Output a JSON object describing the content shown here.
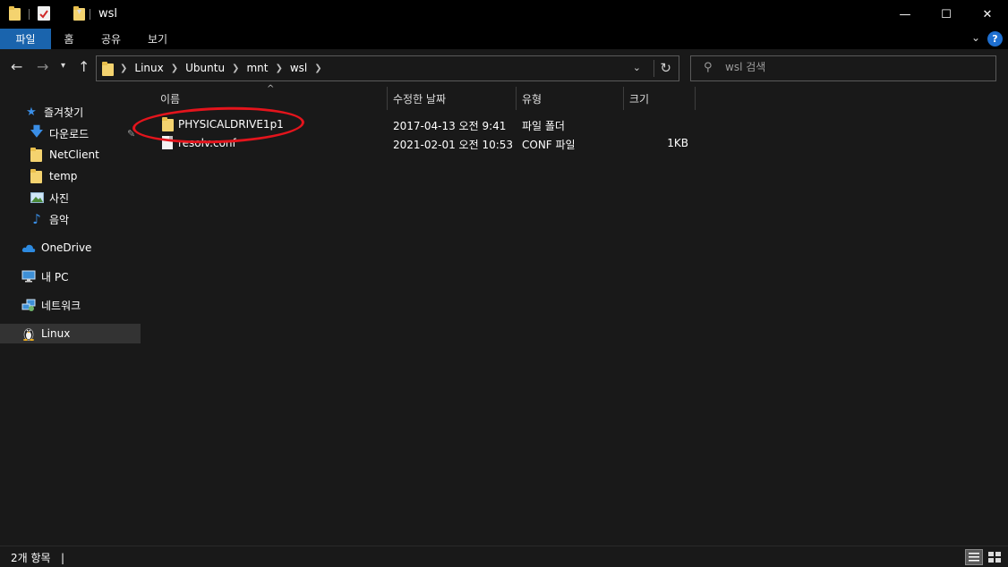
{
  "window": {
    "title": "wsl",
    "minimize_glyph": "—",
    "maximize_glyph": "☐",
    "close_glyph": "✕"
  },
  "ribbon": {
    "tabs": [
      {
        "label": "파일",
        "active": true
      },
      {
        "label": "홈",
        "active": false
      },
      {
        "label": "공유",
        "active": false
      },
      {
        "label": "보기",
        "active": false
      }
    ],
    "help_glyph": "?"
  },
  "address": {
    "crumbs": [
      "Linux",
      "Ubuntu",
      "mnt",
      "wsl"
    ]
  },
  "search": {
    "placeholder": "wsl 검색"
  },
  "sidebar": {
    "items": [
      {
        "label": "즐겨찾기",
        "icon": "star-icon"
      },
      {
        "label": "다운로드",
        "icon": "download-arrow-icon",
        "pinned": true
      },
      {
        "label": "NetClient",
        "icon": "folder-icon"
      },
      {
        "label": "temp",
        "icon": "folder-icon"
      },
      {
        "label": "사진",
        "icon": "pictures-icon"
      },
      {
        "label": "음악",
        "icon": "music-note-icon"
      },
      {
        "label": "OneDrive",
        "icon": "cloud-icon"
      },
      {
        "label": "내 PC",
        "icon": "computer-icon"
      },
      {
        "label": "네트워크",
        "icon": "network-icon"
      },
      {
        "label": "Linux",
        "icon": "penguin-icon",
        "selected": true
      }
    ]
  },
  "columns": {
    "name": "이름",
    "modified": "수정한 날짜",
    "type": "유형",
    "size": "크기"
  },
  "files": [
    {
      "name": "PHYSICALDRIVE1p1",
      "modified": "2017-04-13 오전 9:41",
      "type": "파일 폴더",
      "size": "",
      "icon": "folder-icon"
    },
    {
      "name": "resolv.conf",
      "modified": "2021-02-01 오전 10:53",
      "type": "CONF 파일",
      "size": "1KB",
      "icon": "file-icon"
    }
  ],
  "status": {
    "text": "2개 항목"
  },
  "colors": {
    "accent": "#1a64ad",
    "annotation": "#e4141c",
    "folder": "#f4d36f"
  }
}
